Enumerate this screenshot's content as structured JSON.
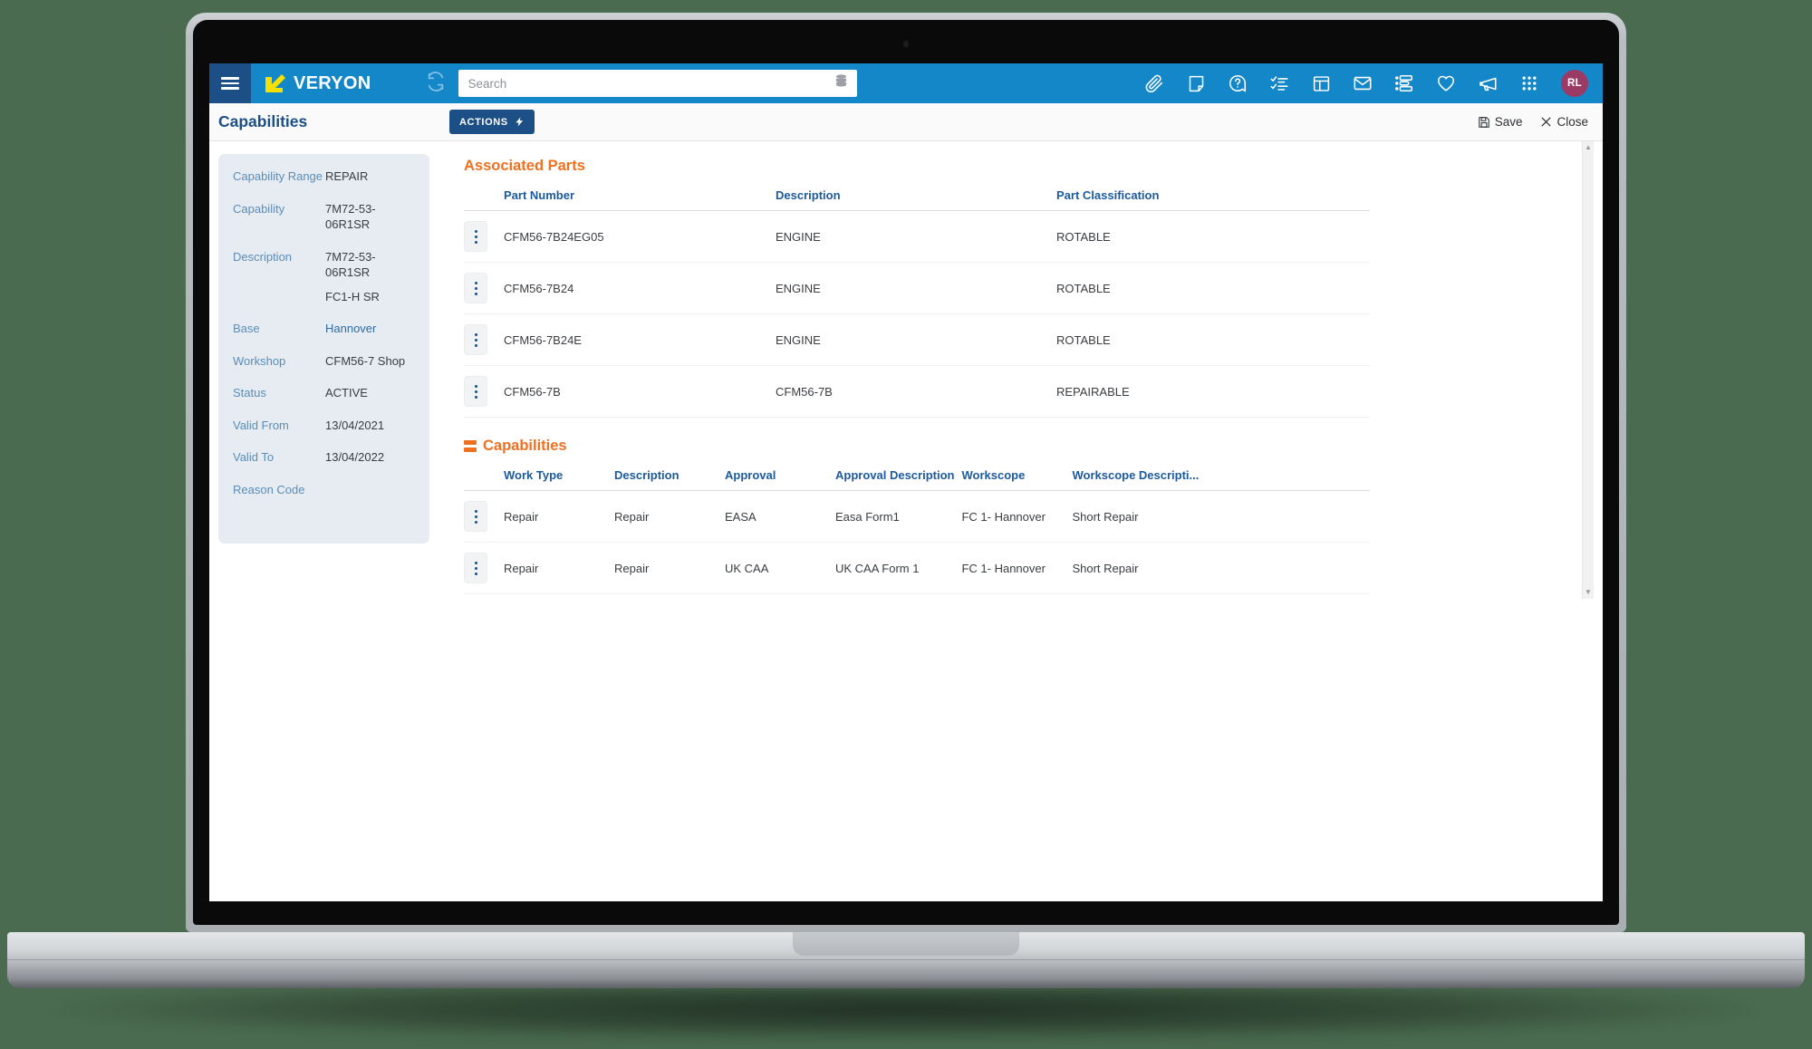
{
  "header": {
    "menu_icon": "hamburger-menu-icon",
    "logo_text": "VERYON",
    "refresh_icon": "refresh-icon",
    "search": {
      "value": "",
      "placeholder": "Search",
      "db_icon": "database-icon"
    },
    "icons": [
      {
        "name": "attachment-icon",
        "label": "Attachments"
      },
      {
        "name": "note-icon",
        "label": "Notes"
      },
      {
        "name": "help-icon",
        "label": "Help"
      },
      {
        "name": "checklist-icon",
        "label": "Tasks"
      },
      {
        "name": "dashboard-icon",
        "label": "Dashboard"
      },
      {
        "name": "mail-icon",
        "label": "Messages"
      },
      {
        "name": "list-settings-icon",
        "label": "Lists"
      },
      {
        "name": "heart-icon",
        "label": "Favorites"
      },
      {
        "name": "megaphone-icon",
        "label": "Announcements"
      },
      {
        "name": "apps-grid-icon",
        "label": "Apps"
      }
    ],
    "avatar_initials": "RL"
  },
  "page": {
    "title": "Capabilities",
    "actions_label": "ACTIONS",
    "save_label": "Save",
    "close_label": "Close"
  },
  "sidebar": {
    "fields": [
      {
        "label": "Capability Range",
        "value": "REPAIR",
        "is_link": false
      },
      {
        "label": "Capability",
        "value": "7M72-53-06R1SR",
        "is_link": false
      },
      {
        "label": "Description",
        "value": "7M72-53-06R1SR",
        "value2": "FC1-H SR",
        "is_link": false
      },
      {
        "label": "Base",
        "value": "Hannover",
        "is_link": true
      },
      {
        "label": "Workshop",
        "value": "CFM56-7 Shop",
        "is_link": false
      },
      {
        "label": "Status",
        "value": "ACTIVE",
        "is_link": false
      },
      {
        "label": "Valid From",
        "value": "13/04/2021",
        "is_link": false
      },
      {
        "label": "Valid To",
        "value": "13/04/2022",
        "is_link": false
      },
      {
        "label": "Reason Code",
        "value": "",
        "is_link": false
      }
    ]
  },
  "associated_parts": {
    "title": "Associated Parts",
    "columns": [
      "Part Number",
      "Description",
      "Part Classification"
    ],
    "rows": [
      {
        "part_number": "CFM56-7B24EG05",
        "description": "ENGINE",
        "classification": "ROTABLE"
      },
      {
        "part_number": "CFM56-7B24",
        "description": "ENGINE",
        "classification": "ROTABLE"
      },
      {
        "part_number": "CFM56-7B24E",
        "description": "ENGINE",
        "classification": "ROTABLE"
      },
      {
        "part_number": "CFM56-7B",
        "description": "CFM56-7B",
        "classification": "REPAIRABLE"
      }
    ]
  },
  "capabilities": {
    "title": "Capabilities",
    "icon": "stacked-rack-icon",
    "columns": [
      "Work Type",
      "Description",
      "Approval",
      "Approval Description",
      "Workscope",
      "Workscope Descripti..."
    ],
    "rows": [
      {
        "work_type": "Repair",
        "description": "Repair",
        "approval": "EASA",
        "approval_description": "Easa Form1",
        "workscope": "FC 1- Hannover",
        "workscope_description": "Short Repair"
      },
      {
        "work_type": "Repair",
        "description": "Repair",
        "approval": "UK CAA",
        "approval_description": "UK CAA Form 1",
        "workscope": "FC 1- Hannover",
        "workscope_description": "Short Repair"
      }
    ]
  },
  "colors": {
    "header_blue": "#1487c8",
    "navy": "#1c4f86",
    "accent_orange": "#f07020",
    "link_blue": "#2e6ca4",
    "label_blue": "#5b8db8",
    "card_bg": "#e6ecf1",
    "avatar_bg": "#9c3a66",
    "logo_yellow": "#f5e000",
    "backdrop_green": "#4a6b4f"
  }
}
